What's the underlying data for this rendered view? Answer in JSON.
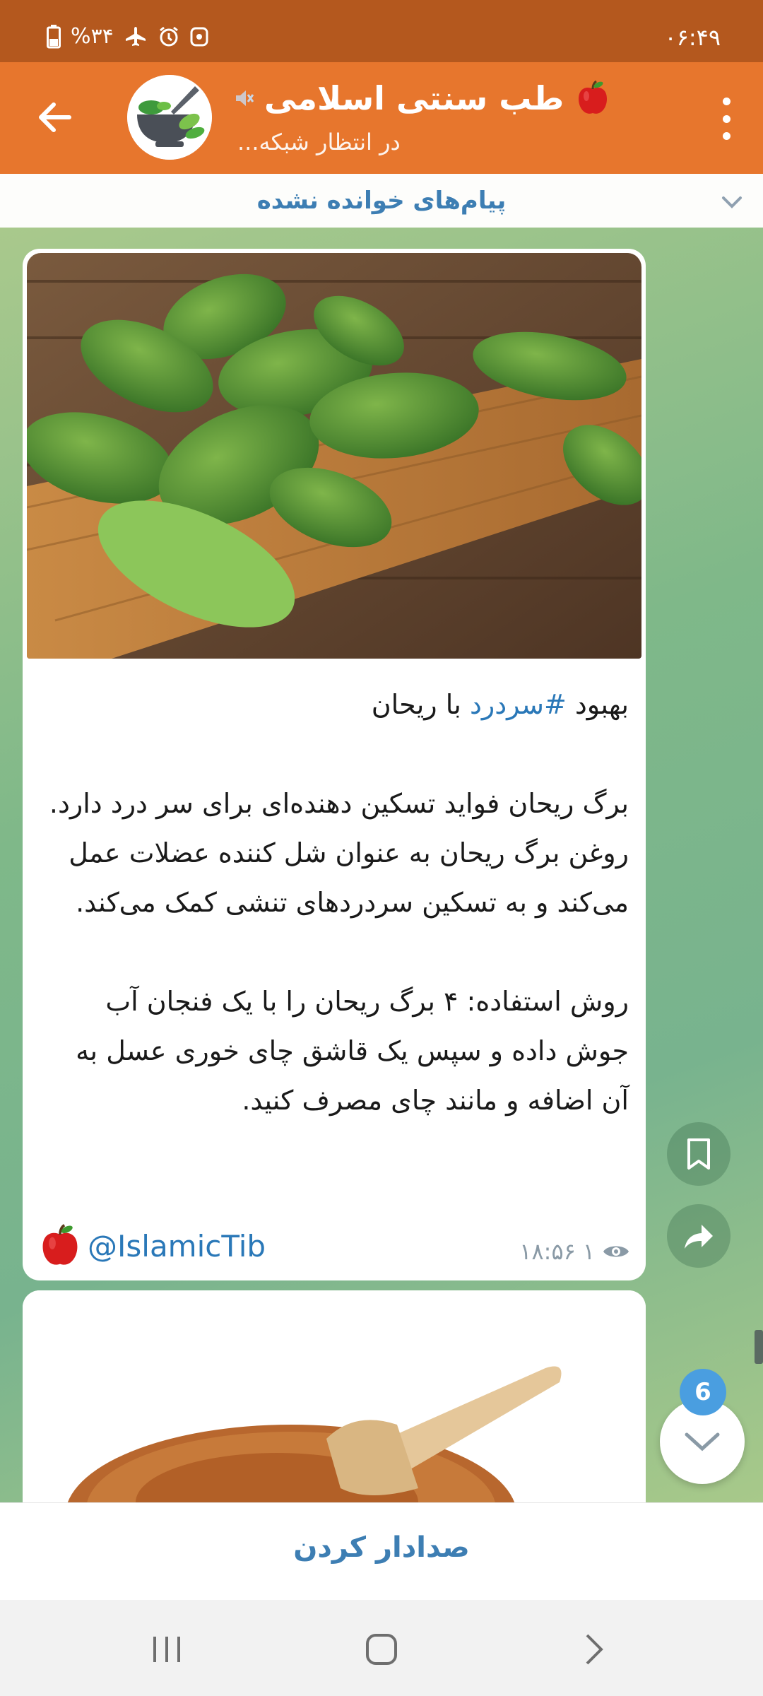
{
  "status_bar": {
    "time": "۰۶:۴۹",
    "battery": "%۳۴",
    "icons": [
      "battery-icon",
      "airplane-icon",
      "alarm-icon",
      "data-saver-icon"
    ]
  },
  "app_bar": {
    "title": "طب سنتی اسلامی",
    "subtitle": "در انتظار شبکه...",
    "muted": true
  },
  "unread_banner": {
    "label": "پیام‌های خوانده نشده"
  },
  "message": {
    "headline_prefix": "بهبود ",
    "hashtag": "#سردرد",
    "headline_suffix": " با ریحان",
    "paragraph1": "برگ ریحان فواید تسکین دهنده‌ای برای سر درد دارد. روغن برگ ریحان به عنوان شل کننده عضلات عمل می‌کند و به تسکین سردردهای تنشی کمک می‌کند.",
    "paragraph2": "روش استفاده: ۴ برگ ریحان را با یک فنجان آب جوش داده و سپس یک قاشق چای خوری عسل به آن اضافه و مانند چای مصرف کنید.",
    "signature": "@IslamicTib",
    "views": "۱",
    "time": "۱۸:۵۶"
  },
  "scroll_down": {
    "badge": "6"
  },
  "bottom_action": {
    "label": "صدادار کردن"
  },
  "colors": {
    "status_bar": "#b4581e",
    "app_bar": "#e7762d",
    "link": "#2a78b8",
    "badge": "#4a9ee0"
  }
}
